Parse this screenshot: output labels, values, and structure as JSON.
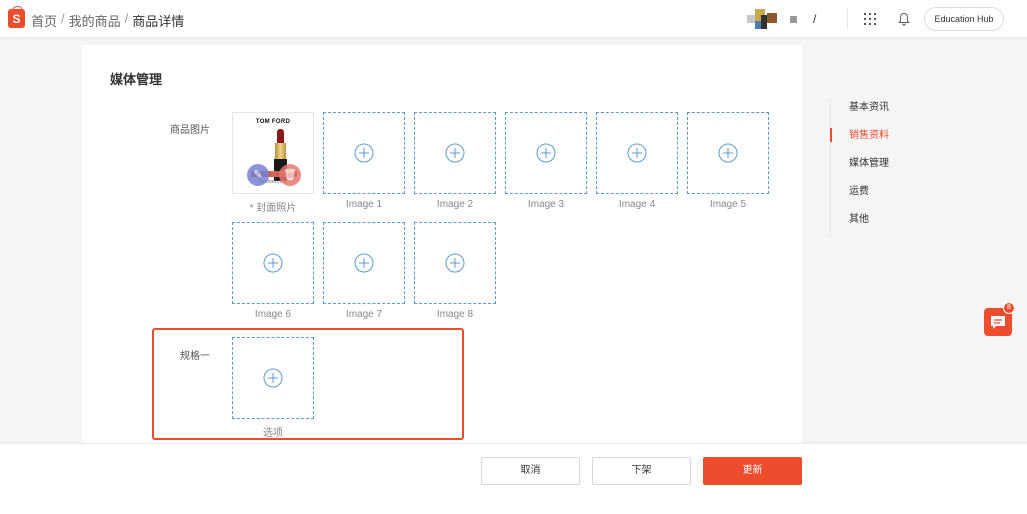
{
  "header": {
    "logo_letter": "S",
    "breadcrumb": {
      "home": "首页",
      "products": "我的商品",
      "current": "商品详情"
    },
    "user_slash": "/",
    "education_hub": "Education Hub"
  },
  "section": {
    "title": "媒体管理",
    "product_images_label": "商品图片",
    "spec_label": "规格一"
  },
  "cover": {
    "brand": "TOM FORD",
    "watermark": "tomford.com",
    "caption": "* 封面照片"
  },
  "image_slots": [
    {
      "label": "Image 1"
    },
    {
      "label": "Image 2"
    },
    {
      "label": "Image 3"
    },
    {
      "label": "Image 4"
    },
    {
      "label": "Image 5"
    },
    {
      "label": "Image 6"
    },
    {
      "label": "Image 7"
    },
    {
      "label": "Image 8"
    }
  ],
  "spec_slot": {
    "label": "选项"
  },
  "side_nav": {
    "items": [
      {
        "label": "基本资讯",
        "active": false
      },
      {
        "label": "销售资料",
        "active": true
      },
      {
        "label": "媒体管理",
        "active": false
      },
      {
        "label": "运费",
        "active": false
      },
      {
        "label": "其他",
        "active": false
      }
    ]
  },
  "chat": {
    "badge": "8"
  },
  "footer": {
    "cancel": "取消",
    "delist": "下架",
    "update": "更新"
  },
  "colors": {
    "brand": "#ee4d2d",
    "dashed_border": "#5b9bd5"
  }
}
